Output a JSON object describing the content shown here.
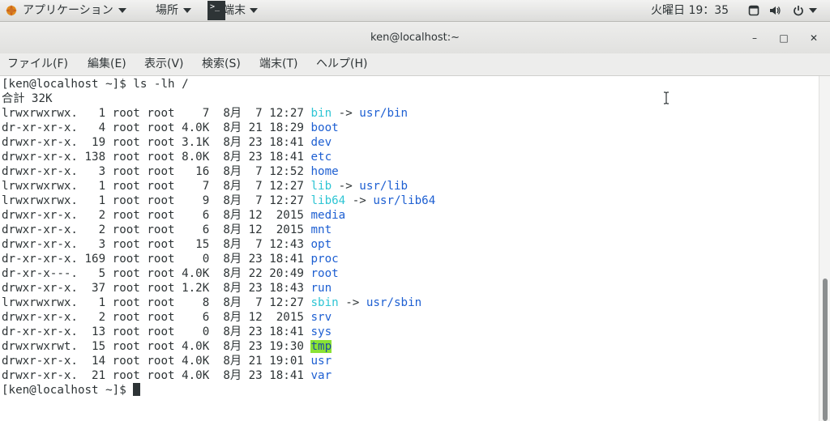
{
  "topbar": {
    "applications": "アプリケーション",
    "places": "場所",
    "task_label": "端末",
    "clock": "火曜日 19：35",
    "icons": [
      "window-icon",
      "volume-icon",
      "power-icon"
    ]
  },
  "window": {
    "title": "ken@localhost:~",
    "minimize": "–",
    "maximize": "□",
    "close": "✕"
  },
  "menubar": {
    "items": [
      "ファイル(F)",
      "編集(E)",
      "表示(V)",
      "検索(S)",
      "端末(T)",
      "ヘルプ(H)"
    ]
  },
  "terminal": {
    "prompt": "[ken@localhost ~]$ ",
    "command": "ls -lh /",
    "total": "合計 32K",
    "rows": [
      {
        "prefix": "lrwxrwxrwx.   1 root root    7  8月  7 12:27 ",
        "name": "bin",
        "style": "cyan",
        "arrow": " -> ",
        "target": "usr/bin"
      },
      {
        "prefix": "dr-xr-xr-x.   4 root root 4.0K  8月 21 18:29 ",
        "name": "boot",
        "style": "blue"
      },
      {
        "prefix": "drwxr-xr-x.  19 root root 3.1K  8月 23 18:41 ",
        "name": "dev",
        "style": "blue"
      },
      {
        "prefix": "drwxr-xr-x. 138 root root 8.0K  8月 23 18:41 ",
        "name": "etc",
        "style": "blue"
      },
      {
        "prefix": "drwxr-xr-x.   3 root root   16  8月  7 12:52 ",
        "name": "home",
        "style": "blue"
      },
      {
        "prefix": "lrwxrwxrwx.   1 root root    7  8月  7 12:27 ",
        "name": "lib",
        "style": "cyan",
        "arrow": " -> ",
        "target": "usr/lib"
      },
      {
        "prefix": "lrwxrwxrwx.   1 root root    9  8月  7 12:27 ",
        "name": "lib64",
        "style": "cyan",
        "arrow": " -> ",
        "target": "usr/lib64"
      },
      {
        "prefix": "drwxr-xr-x.   2 root root    6  8月 12  2015 ",
        "name": "media",
        "style": "blue"
      },
      {
        "prefix": "drwxr-xr-x.   2 root root    6  8月 12  2015 ",
        "name": "mnt",
        "style": "blue"
      },
      {
        "prefix": "drwxr-xr-x.   3 root root   15  8月  7 12:43 ",
        "name": "opt",
        "style": "blue"
      },
      {
        "prefix": "dr-xr-xr-x. 169 root root    0  8月 23 18:41 ",
        "name": "proc",
        "style": "blue"
      },
      {
        "prefix": "dr-xr-x---.   5 root root 4.0K  8月 22 20:49 ",
        "name": "root",
        "style": "blue"
      },
      {
        "prefix": "drwxr-xr-x.  37 root root 1.2K  8月 23 18:43 ",
        "name": "run",
        "style": "blue"
      },
      {
        "prefix": "lrwxrwxrwx.   1 root root    8  8月  7 12:27 ",
        "name": "sbin",
        "style": "cyan",
        "arrow": " -> ",
        "target": "usr/sbin"
      },
      {
        "prefix": "drwxr-xr-x.   2 root root    6  8月 12  2015 ",
        "name": "srv",
        "style": "blue"
      },
      {
        "prefix": "dr-xr-xr-x.  13 root root    0  8月 23 18:41 ",
        "name": "sys",
        "style": "blue"
      },
      {
        "prefix": "drwxrwxrwt.  15 root root 4.0K  8月 23 19:30 ",
        "name": "tmp",
        "style": "tmpbg"
      },
      {
        "prefix": "drwxr-xr-x.  14 root root 4.0K  8月 21 19:01 ",
        "name": "usr",
        "style": "blue"
      },
      {
        "prefix": "drwxr-xr-x.  21 root root 4.0K  8月 23 18:41 ",
        "name": "var",
        "style": "blue"
      }
    ]
  },
  "colors": {
    "symlink": "#2ec5d4",
    "directory": "#1d5fd2",
    "sticky_bg": "#8ae234",
    "text": "#2e3436"
  }
}
